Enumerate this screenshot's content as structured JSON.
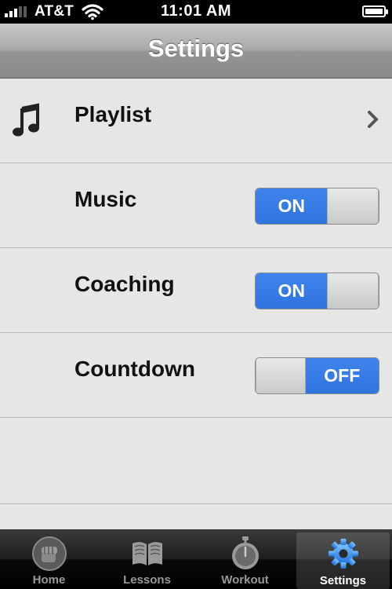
{
  "status_bar": {
    "carrier": "AT&T",
    "time": "11:01 AM"
  },
  "nav": {
    "title": "Settings"
  },
  "settings": {
    "playlist": {
      "label": "Playlist",
      "icon": "music-note-icon"
    },
    "music": {
      "label": "Music",
      "value": "ON"
    },
    "coaching": {
      "label": "Coaching",
      "value": "ON"
    },
    "countdown": {
      "label": "Countdown",
      "value": "OFF"
    }
  },
  "tabs": [
    {
      "label": "Home",
      "icon": "fist-icon"
    },
    {
      "label": "Lessons",
      "icon": "book-icon"
    },
    {
      "label": "Workout",
      "icon": "stopwatch-icon"
    },
    {
      "label": "Settings",
      "icon": "gear-icon",
      "active": true
    }
  ],
  "colors": {
    "toggle_on": "#3a7fe8",
    "nav_bar": "#a9a9a9",
    "background": "#e6e6e6"
  }
}
